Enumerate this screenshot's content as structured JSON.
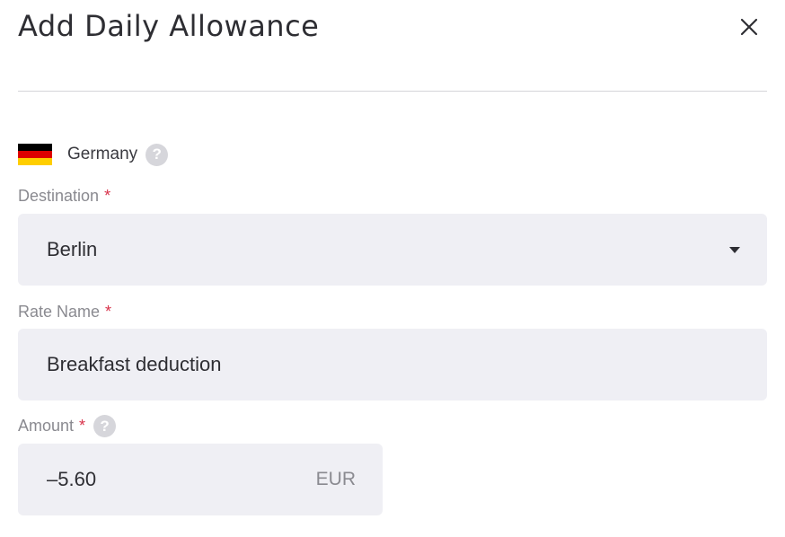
{
  "dialog": {
    "title": "Add Daily Allowance",
    "close_icon": "close-icon"
  },
  "country": {
    "name": "Germany",
    "flag_colors": [
      "#000000",
      "#dd0000",
      "#ffce00"
    ],
    "help_icon": "help-icon",
    "help_glyph": "?"
  },
  "destination": {
    "label": "Destination",
    "required_mark": "*",
    "value": "Berlin",
    "dropdown_icon": "caret-down-icon"
  },
  "rate_name": {
    "label": "Rate Name",
    "required_mark": "*",
    "value": "Breakfast deduction"
  },
  "amount": {
    "label": "Amount",
    "required_mark": "*",
    "help_glyph": "?",
    "value": "–5.60",
    "currency": "EUR"
  }
}
